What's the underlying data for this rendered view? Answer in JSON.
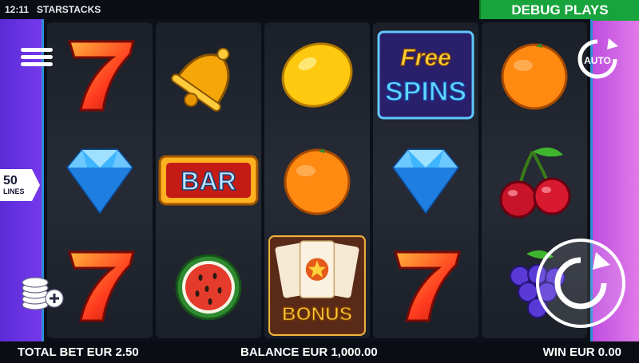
{
  "status_bar": {
    "time": "12:11",
    "game_title": "STARSTACKS"
  },
  "debug_button": {
    "label": "DEBUG PLAYS"
  },
  "lines": {
    "count": "50",
    "label": "LINES"
  },
  "auto_button": {
    "label": "AUTO",
    "icon": "autoplay-icon"
  },
  "menu_button": {
    "icon": "hamburger-menu-icon"
  },
  "coins_button": {
    "icon": "coin-stack-plus-icon"
  },
  "spin_button": {
    "icon": "spin-arrow-icon"
  },
  "reels": [
    [
      "seven",
      "diamond",
      "seven"
    ],
    [
      "bell",
      "bar",
      "watermelon"
    ],
    [
      "lemon",
      "orange",
      "bonus"
    ],
    [
      "free-spins",
      "diamond",
      "seven"
    ],
    [
      "orange",
      "cherries",
      "grapes"
    ]
  ],
  "symbol_text": {
    "bar": "BAR",
    "free": "Free",
    "spins": "SPINS",
    "bonus": "BONUS"
  },
  "footer": {
    "total_bet": "TOTAL BET EUR 2.50",
    "balance": "BALANCE EUR 1,000.00",
    "win": "WIN EUR 0.00"
  },
  "colors": {
    "accent_green": "#18a43c",
    "frame_blue": "#2b8fd6",
    "left_glow": "#7b3cf0",
    "right_glow": "#e07be8"
  }
}
